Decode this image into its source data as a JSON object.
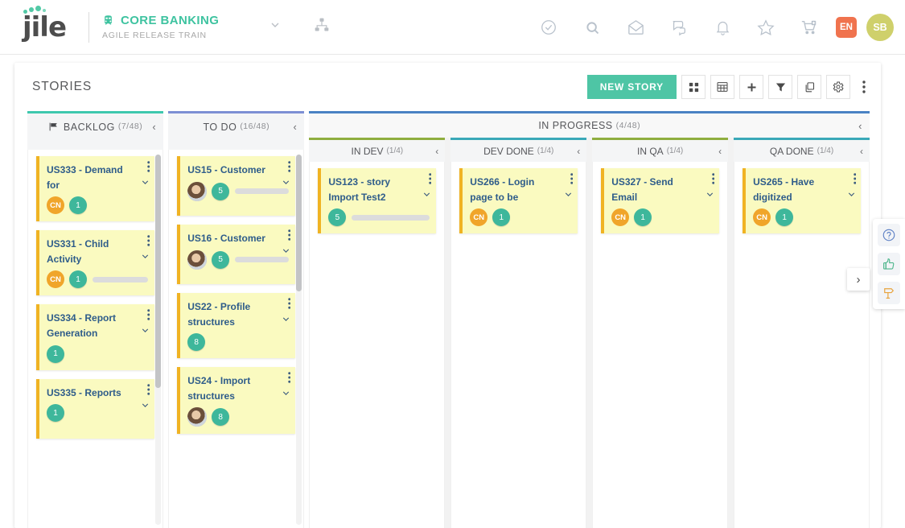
{
  "header": {
    "logo_text": "jile",
    "project_name": "CORE BANKING",
    "project_subtitle": "AGILE RELEASE TRAIN",
    "train_icon": "train-icon",
    "dropdown_icon": "chevron-down-icon",
    "org_icon": "org-chart-icon",
    "icons": [
      {
        "name": "check-circle-icon"
      },
      {
        "name": "search-icon"
      },
      {
        "name": "mail-icon"
      },
      {
        "name": "chat-icon"
      },
      {
        "name": "bell-icon"
      },
      {
        "name": "star-icon"
      },
      {
        "name": "cart-plus-icon"
      }
    ],
    "language": "EN",
    "user_initials": "SB"
  },
  "panel": {
    "title": "STORIES",
    "new_story_label": "NEW STORY",
    "tools": [
      {
        "name": "card-view-icon"
      },
      {
        "name": "grid-view-icon"
      },
      {
        "name": "add-icon"
      },
      {
        "name": "filter-icon"
      },
      {
        "name": "copy-icon"
      },
      {
        "name": "settings-icon"
      }
    ],
    "more_icon": "kebab-menu-icon"
  },
  "board": {
    "columns": [
      {
        "id": "backlog",
        "label": "BACKLOG",
        "count": "(7/48)",
        "accent": "#3ec8ae",
        "flag_icon": "flag-icon",
        "collapse_icon": "chevron-left-icon",
        "cards": [
          {
            "title": "US333 - Demand for",
            "avatar": "CN",
            "avatar_type": "initials",
            "points": "1",
            "bar": false
          },
          {
            "title": "US331 - Child Activity",
            "avatar": "CN",
            "avatar_type": "initials",
            "points": "1",
            "bar": true
          },
          {
            "title": "US334 - Report Generation",
            "avatar": null,
            "avatar_type": "none",
            "points": "1",
            "bar": false
          },
          {
            "title": "US335 - Reports",
            "avatar": null,
            "avatar_type": "none",
            "points": "1",
            "bar": false
          }
        ]
      },
      {
        "id": "todo",
        "label": "TO DO",
        "count": "(16/48)",
        "accent": "#7c8fd4",
        "collapse_icon": "chevron-left-icon",
        "cards": [
          {
            "title": "US15 - Customer",
            "avatar": "photo",
            "avatar_type": "photo",
            "points": "5",
            "bar": true
          },
          {
            "title": "US16 - Customer",
            "avatar": "photo",
            "avatar_type": "photo",
            "points": "5",
            "bar": true
          },
          {
            "title": "US22 - Profile structures",
            "avatar": null,
            "avatar_type": "none",
            "points": "8",
            "bar": false
          },
          {
            "title": "US24 - Import structures",
            "avatar": "photo",
            "avatar_type": "photo",
            "points": "8",
            "bar": false
          }
        ]
      }
    ],
    "in_progress": {
      "label": "IN PROGRESS",
      "count": "(4/48)",
      "accent": "#4a82c4",
      "collapse_icon": "chevron-left-icon",
      "subcolumns": [
        {
          "id": "in-dev",
          "label": "IN DEV",
          "count": "(1/4)",
          "accent": "#8fae3f",
          "collapse_icon": "chevron-left-icon",
          "cards": [
            {
              "title": "US123 - story Import Test2",
              "avatar": null,
              "avatar_type": "none",
              "points": "5",
              "bar": true
            }
          ]
        },
        {
          "id": "dev-done",
          "label": "DEV DONE",
          "count": "(1/4)",
          "accent": "#3aa9b8",
          "collapse_icon": "chevron-left-icon",
          "cards": [
            {
              "title": "US266 - Login page to be",
              "avatar": "CN",
              "avatar_type": "initials",
              "points": "1",
              "bar": false
            }
          ]
        },
        {
          "id": "in-qa",
          "label": "IN QA",
          "count": "(1/4)",
          "accent": "#8fae3f",
          "collapse_icon": "chevron-left-icon",
          "cards": [
            {
              "title": "US327 - Send Email",
              "avatar": "CN",
              "avatar_type": "initials",
              "points": "1",
              "bar": false
            }
          ]
        },
        {
          "id": "qa-done",
          "label": "QA DONE",
          "count": "(1/4)",
          "accent": "#3aa9b8",
          "collapse_icon": "chevron-left-icon",
          "cards": [
            {
              "title": "US265 - Have digitized",
              "avatar": "CN",
              "avatar_type": "initials",
              "points": "1",
              "bar": false
            }
          ]
        }
      ]
    }
  },
  "help_widget": {
    "icons": [
      {
        "name": "help-question-icon",
        "color": "#5b7fc4"
      },
      {
        "name": "thumbs-up-icon",
        "color": "#4bb58a"
      },
      {
        "name": "signpost-icon",
        "color": "#e8a33d"
      }
    ]
  },
  "expander": {
    "icon": "chevron-right-icon",
    "glyph": "›"
  },
  "colors": {
    "brand_teal": "#3ec3a0",
    "card_bg": "#fafac0",
    "card_border": "#f0b323",
    "points_badge": "#3eb79b",
    "avatar_orange": "#f0a52a",
    "title_blue": "#2e5c8a"
  }
}
